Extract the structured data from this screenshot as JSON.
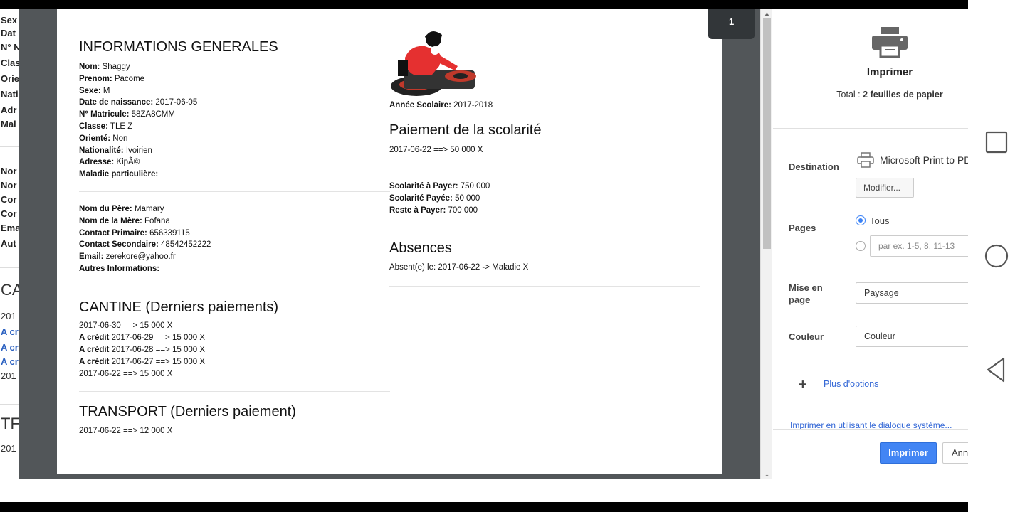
{
  "background_page": {
    "lines": [
      "Sex",
      "Dat",
      "N° N",
      "Clas",
      "Orie",
      "Nati",
      "Adr",
      "Mal",
      "Nor",
      "Nor",
      "Cor",
      "Cor",
      "Ema",
      "Aut",
      "CA",
      "201",
      "A cr",
      "A cr",
      "A cr",
      "201",
      "TF",
      "201"
    ]
  },
  "preview": {
    "page_number": "1",
    "informations": {
      "heading": "INFORMATIONS GENERALES",
      "fields": [
        {
          "label": "Nom:",
          "value": "Shaggy"
        },
        {
          "label": "Prenom:",
          "value": "Pacome"
        },
        {
          "label": "Sexe:",
          "value": "M"
        },
        {
          "label": "Date de naissance:",
          "value": "2017-06-05"
        },
        {
          "label": "N° Matricule:",
          "value": "58ZA8CMM"
        },
        {
          "label": "Classe:",
          "value": "TLE Z"
        },
        {
          "label": "Orienté:",
          "value": "Non"
        },
        {
          "label": "Nationalité:",
          "value": "Ivoirien"
        },
        {
          "label": "Adresse:",
          "value": "KipÃ©"
        },
        {
          "label": "Maladie particulière:",
          "value": ""
        }
      ],
      "parents": [
        {
          "label": "Nom du Père:",
          "value": "Mamary"
        },
        {
          "label": "Nom de la Mère:",
          "value": "Fofana"
        },
        {
          "label": "Contact Primaire:",
          "value": "656339115"
        },
        {
          "label": "Contact Secondaire:",
          "value": "48542452222"
        },
        {
          "label": "Email:",
          "value": "zerekore@yahoo.fr"
        },
        {
          "label": "Autres Informations:",
          "value": ""
        }
      ]
    },
    "cantine": {
      "heading": "CANTINE (Derniers paiements)",
      "entries": [
        {
          "prefix": "",
          "text": "2017-06-30 ==> 15 000 X"
        },
        {
          "prefix": "A crédit",
          "text": "2017-06-29 ==> 15 000 X"
        },
        {
          "prefix": "A crédit",
          "text": "2017-06-28 ==> 15 000 X"
        },
        {
          "prefix": "A crédit",
          "text": "2017-06-27 ==> 15 000 X"
        },
        {
          "prefix": "",
          "text": "2017-06-22 ==> 15 000 X"
        }
      ]
    },
    "transport": {
      "heading": "TRANSPORT (Derniers paiement)",
      "entries": [
        "2017-06-22 ==> 12 000 X"
      ]
    },
    "annee": {
      "label": "Année Scolaire:",
      "value": "2017-2018"
    },
    "scolarite": {
      "heading": "Paiement de la scolarité",
      "entries": [
        "2017-06-22 ==> 50 000 X"
      ],
      "summary": [
        {
          "label": "Scolarité à Payer:",
          "value": "750 000"
        },
        {
          "label": "Scolarité Payée:",
          "value": "50 000"
        },
        {
          "label": "Reste à Payer:",
          "value": "700 000"
        }
      ]
    },
    "absences": {
      "heading": "Absences",
      "entries": [
        "Absent(e) le: 2017-06-22 -> Maladie X"
      ]
    }
  },
  "print_panel": {
    "title": "Imprimer",
    "total_label": "Total :",
    "total_value": "2 feuilles de papier",
    "destination_label": "Destination",
    "destination_value": "Microsoft Print to PDF",
    "modify_button": "Modifier...",
    "pages_label": "Pages",
    "pages_all": "Tous",
    "pages_placeholder": "par ex. 1-5, 8, 11-13",
    "layout_label": "Mise en page",
    "layout_value": "Paysage",
    "color_label": "Couleur",
    "color_value": "Couleur",
    "more_options": "Plus d'options",
    "system_dialog": "Imprimer en utilisant le dialogue système...",
    "print_button": "Imprimer",
    "cancel_button": "Annuler"
  },
  "colors": {
    "accent": "#4285f4",
    "link": "#3367d6",
    "preview_bg": "#525659"
  }
}
